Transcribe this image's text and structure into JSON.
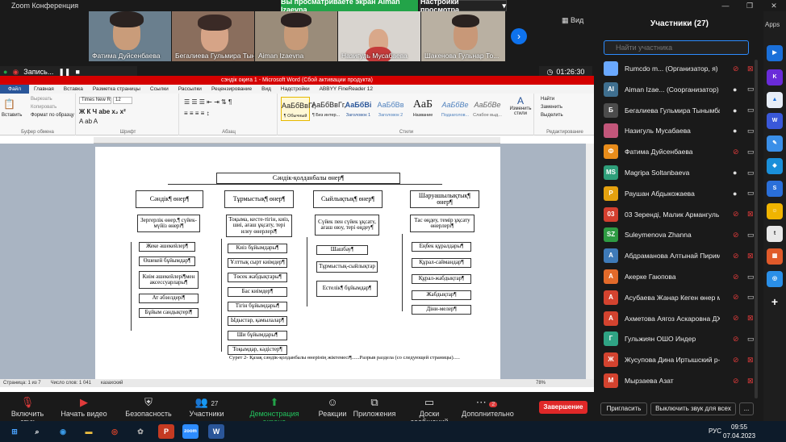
{
  "app": {
    "title": "Zoom Конференция"
  },
  "banner": {
    "viewing": "Вы просматриваете экран Aiman Izaevna",
    "view_options": "Настройки просмотра",
    "view_button": "Вид"
  },
  "video_tiles": [
    {
      "name": "Фатима Дуйсенбаева"
    },
    {
      "name": "Бегалиева Гульмира Тын..."
    },
    {
      "name": "Aiman Izaevna"
    },
    {
      "name": "Назигуль Мусабаева"
    },
    {
      "name": "Шакенова Гульнар То..."
    }
  ],
  "recording": {
    "label": "Запись...",
    "timer": "01:26:30"
  },
  "word": {
    "title": "сэндік оқиға 1 - Microsoft Word (Сбой активации продукта)",
    "menu": [
      "Файл",
      "Главная",
      "Вставка",
      "Разметка страницы",
      "Ссылки",
      "Рассылки",
      "Рецензирование",
      "Вид",
      "Надстройки",
      "ABBYY FineReader 12"
    ],
    "ribbon": {
      "paste": "Вставить",
      "cut": "Вырезать",
      "copy": "Копировать",
      "format_painter": "Формат по образцу",
      "font_name": "Times New R",
      "font_size": "12",
      "group_clipboard": "Буфер обмена",
      "group_font": "Шрифт",
      "group_paragraph": "Абзац",
      "group_styles": "Стили",
      "group_editing": "Редактирование",
      "find": "Найти",
      "replace": "Заменить",
      "select": "Выделить",
      "change_styles": "Изменить стили",
      "styles": [
        {
          "sample": "АаБбВвГг,",
          "name": "¶ Обычный"
        },
        {
          "sample": "АаБбВвГг,",
          "name": "¶ Без интер..."
        },
        {
          "sample": "АаБбВі",
          "name": "Заголовок 1"
        },
        {
          "sample": "АаБбВв",
          "name": "Заголовок 2"
        },
        {
          "sample": "АаБ",
          "name": "Название"
        },
        {
          "sample": "АаБбВе",
          "name": "Подзаголов..."
        },
        {
          "sample": "АаБбВе",
          "name": "Слабое выд..."
        }
      ]
    },
    "diagram": {
      "root": "Сәндік-қолданбалы өнер¶",
      "categories": [
        {
          "title": "Сәндік¶ өнер¶",
          "subtitle": "Зергерлік өнер,¶ сүйек-мүйіз өнері¶",
          "items": [
            "Жеке әшекейлер¶",
            "Өшекей бұйымдар¶",
            "Киім әшекейлері¶мен аксессуарлары¶",
            "Ат әбзелдері¶",
            "Бұйым сандықтері¶"
          ]
        },
        {
          "title": "Тұрмыстық¶ өнер¶",
          "subtitle": "Тоқыма, кесте-тігін, киіз, шиі, ағаш ұқсату, тері илеу өнерлері¶",
          "items": [
            "Киіз бұйымдары¶",
            "Ұлттық сырт киімдер¶",
            "Төсек жабдықтары¶",
            "Бас киімдер¶",
            "Тігін бұйымдары¶",
            "Ыдыстар, қамылалар¶",
            "Ши бұйымдары¶",
            "Тоқымдар, кәдістер¶"
          ]
        },
        {
          "title": "Сыйлықтық¶ өнер¶",
          "subtitle": "Сүйек пен сүйек ұқсату, ағаш оюу, тері өңдеу¶",
          "items": [
            "Шашбау¶",
            "Тұрмыстық-сыйлықтар",
            "Естелік¶ бұйымдар¶"
          ]
        },
        {
          "title": "Шаруашылықтық¶ өнер¶",
          "subtitle": "Тас өңдеу, темір ұқсату өнерлері¶",
          "items": [
            "Еңбек құралдары¶",
            "Құрал-саймандар¶",
            "Құрал-жабдықтар¶",
            "Жабдықтар¶",
            "Діни-мелер¶"
          ]
        }
      ],
      "caption": "Сурет 2- Қазақ сәндік-қолданбалы өнерінің жіктемесі¶......Разрыв раздела (со следующей страницы)....."
    },
    "status": {
      "page": "Страница: 1 из 7",
      "words": "Число слов: 1 041",
      "lang": "казахский",
      "zoom": "78%"
    }
  },
  "toolbar": {
    "audio": "Включить звук",
    "video": "Начать видео",
    "security": "Безопасность",
    "participants": "Участники",
    "participants_count": "27",
    "share": "Демонстрация экрана",
    "reactions": "Реакции",
    "apps": "Приложения",
    "whiteboard": "Доски сообщений",
    "more": "Дополнительно",
    "more_badge": "2",
    "end": "Завершение"
  },
  "participants": {
    "title": "Участники (27)",
    "search_placeholder": "Найти участника",
    "list": [
      {
        "initials": "",
        "name": "Rumcdo m... (Организатор, я)",
        "color": "#6aa9ff",
        "mic": "off",
        "cam": "off"
      },
      {
        "initials": "AI",
        "name": "Aiman Izae... (Соорганизатор)",
        "color": "#3f6f8f",
        "mic": "on",
        "cam": "on"
      },
      {
        "initials": "Б",
        "name": "Бегалиева Гульмира Тынымбае...",
        "color": "#4c4c4c",
        "mic": "on",
        "cam": "on"
      },
      {
        "initials": "",
        "name": "Назигуль Мусабаева",
        "color": "#c2567a",
        "mic": "on",
        "cam": "on"
      },
      {
        "initials": "Ф",
        "name": "Фатима Дуйсенбаева",
        "color": "#e88c1a",
        "mic": "off",
        "cam": "on"
      },
      {
        "initials": "MS",
        "name": "Magripa Soltanbaeva",
        "color": "#2f9f7a",
        "mic": "on",
        "cam": "on"
      },
      {
        "initials": "Р",
        "name": "Раушан Абдыкожаева",
        "color": "#e4a10f",
        "mic": "on",
        "cam": "on"
      },
      {
        "initials": "03",
        "name": "03  Зерендi, Малик Армангуль",
        "color": "#d33f2f",
        "mic": "off",
        "cam": "off"
      },
      {
        "initials": "SZ",
        "name": "Suleymenova Zhanna",
        "color": "#2e9b43",
        "mic": "off",
        "cam": "on"
      },
      {
        "initials": "А",
        "name": "Абдраманова Алтынай Пиримб...",
        "color": "#3e7ab8",
        "mic": "off",
        "cam": "off"
      },
      {
        "initials": "А",
        "name": "Акерке Гаюпова",
        "color": "#e26a2a",
        "mic": "off",
        "cam": "on"
      },
      {
        "initials": "А",
        "name": "Асубаева Жанар Кеген өнер ме...",
        "color": "#d3432f",
        "mic": "off",
        "cam": "on"
      },
      {
        "initials": "А",
        "name": "Ахметова Аягоз Аскаровна ДХ...",
        "color": "#d3432f",
        "mic": "off",
        "cam": "off"
      },
      {
        "initials": "Г",
        "name": "Гульжиян ОШО Индер",
        "color": "#2fa384",
        "mic": "off",
        "cam": "on"
      },
      {
        "initials": "Ж",
        "name": "Жусупова Дина Иртышский р-н...",
        "color": "#d3432f",
        "mic": "off",
        "cam": "off"
      },
      {
        "initials": "М",
        "name": "Мырзаева Азат",
        "color": "#d3432f",
        "mic": "off",
        "cam": "off"
      }
    ],
    "invite": "Пригласить",
    "mute_all": "Выключить звук для всех",
    "more": "..."
  },
  "dock": {
    "apps_label": "Apps"
  },
  "taskbar": {
    "lang": "РУС",
    "time": "09:55",
    "date": "07.04.2023"
  }
}
